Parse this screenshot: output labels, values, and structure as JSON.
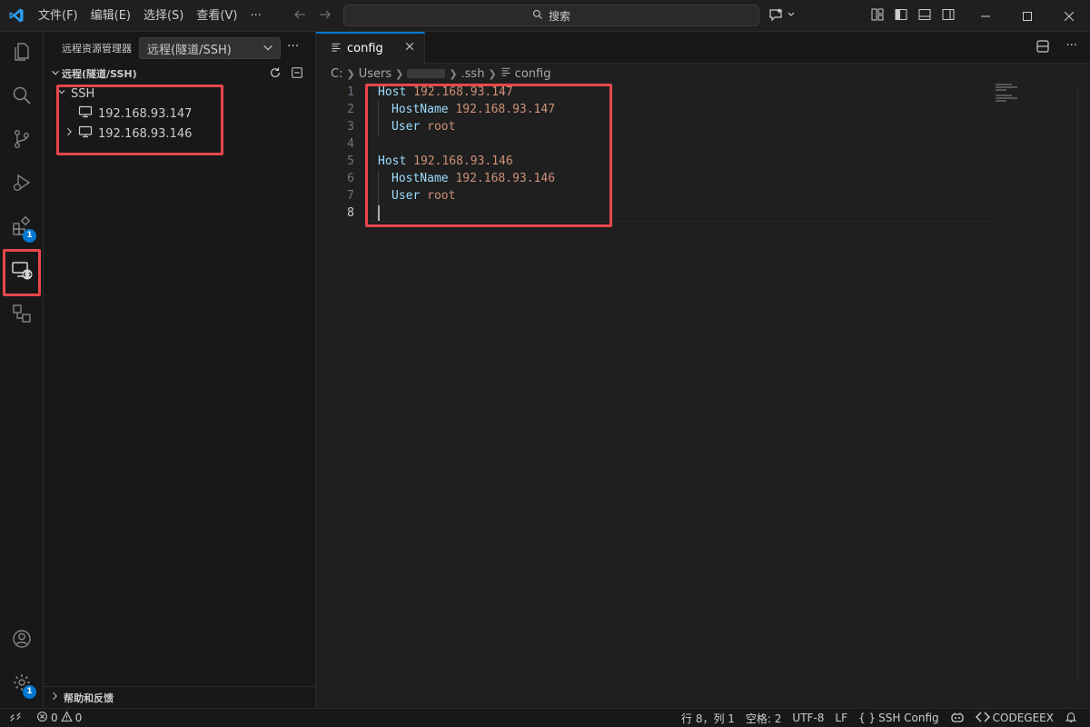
{
  "titlebar": {
    "menu": [
      "文件(F)",
      "编辑(E)",
      "选择(S)",
      "查看(V)",
      "···"
    ],
    "search_label": "搜索"
  },
  "activitybar": {
    "items": [
      {
        "icon": "files-icon"
      },
      {
        "icon": "search-icon"
      },
      {
        "icon": "source-control-icon"
      },
      {
        "icon": "run-debug-icon"
      },
      {
        "icon": "extensions-icon",
        "badge": "1"
      },
      {
        "icon": "remote-explorer-icon"
      },
      {
        "icon": "remote-explorer-tunnels-icon"
      }
    ],
    "bottom": [
      {
        "icon": "account-icon"
      },
      {
        "icon": "settings-gear-icon",
        "badge": "1"
      }
    ]
  },
  "sidebar": {
    "title": "远程资源管理器",
    "selected_view": "远程(隧道/SSH)",
    "section_title": "远程(隧道/SSH)",
    "group_label": "SSH",
    "hosts": [
      {
        "label": "192.168.93.147",
        "expandable": false
      },
      {
        "label": "192.168.93.146",
        "expandable": true
      }
    ],
    "footer_section": "帮助和反馈"
  },
  "editor": {
    "tab_label": "config",
    "breadcrumbs": [
      "C:",
      "Users",
      ".ssh",
      "config"
    ],
    "lines": [
      {
        "n": "1",
        "key": "Host",
        "value": "192.168.93.147",
        "indent": false
      },
      {
        "n": "2",
        "key": "HostName",
        "value": "192.168.93.147",
        "indent": true
      },
      {
        "n": "3",
        "key": "User",
        "value": "root",
        "indent": true
      },
      {
        "n": "4",
        "key": "",
        "value": "",
        "indent": false
      },
      {
        "n": "5",
        "key": "Host",
        "value": "192.168.93.146",
        "indent": false
      },
      {
        "n": "6",
        "key": "HostName",
        "value": "192.168.93.146",
        "indent": true
      },
      {
        "n": "7",
        "key": "User",
        "value": "root",
        "indent": true
      },
      {
        "n": "8",
        "key": "",
        "value": "",
        "indent": false
      }
    ],
    "active_line": "8"
  },
  "statusbar": {
    "errors": "0",
    "warnings": "0",
    "position": "行 8，列 1",
    "indent": "空格: 2",
    "encoding": "UTF-8",
    "eol": "LF",
    "language": "SSH Config",
    "extension": "CODEGEEX"
  },
  "colors": {
    "accent": "#0078d4",
    "highlight_box": "#e8474b",
    "keyword": "#9cdcfe",
    "value": "#ce9178"
  }
}
